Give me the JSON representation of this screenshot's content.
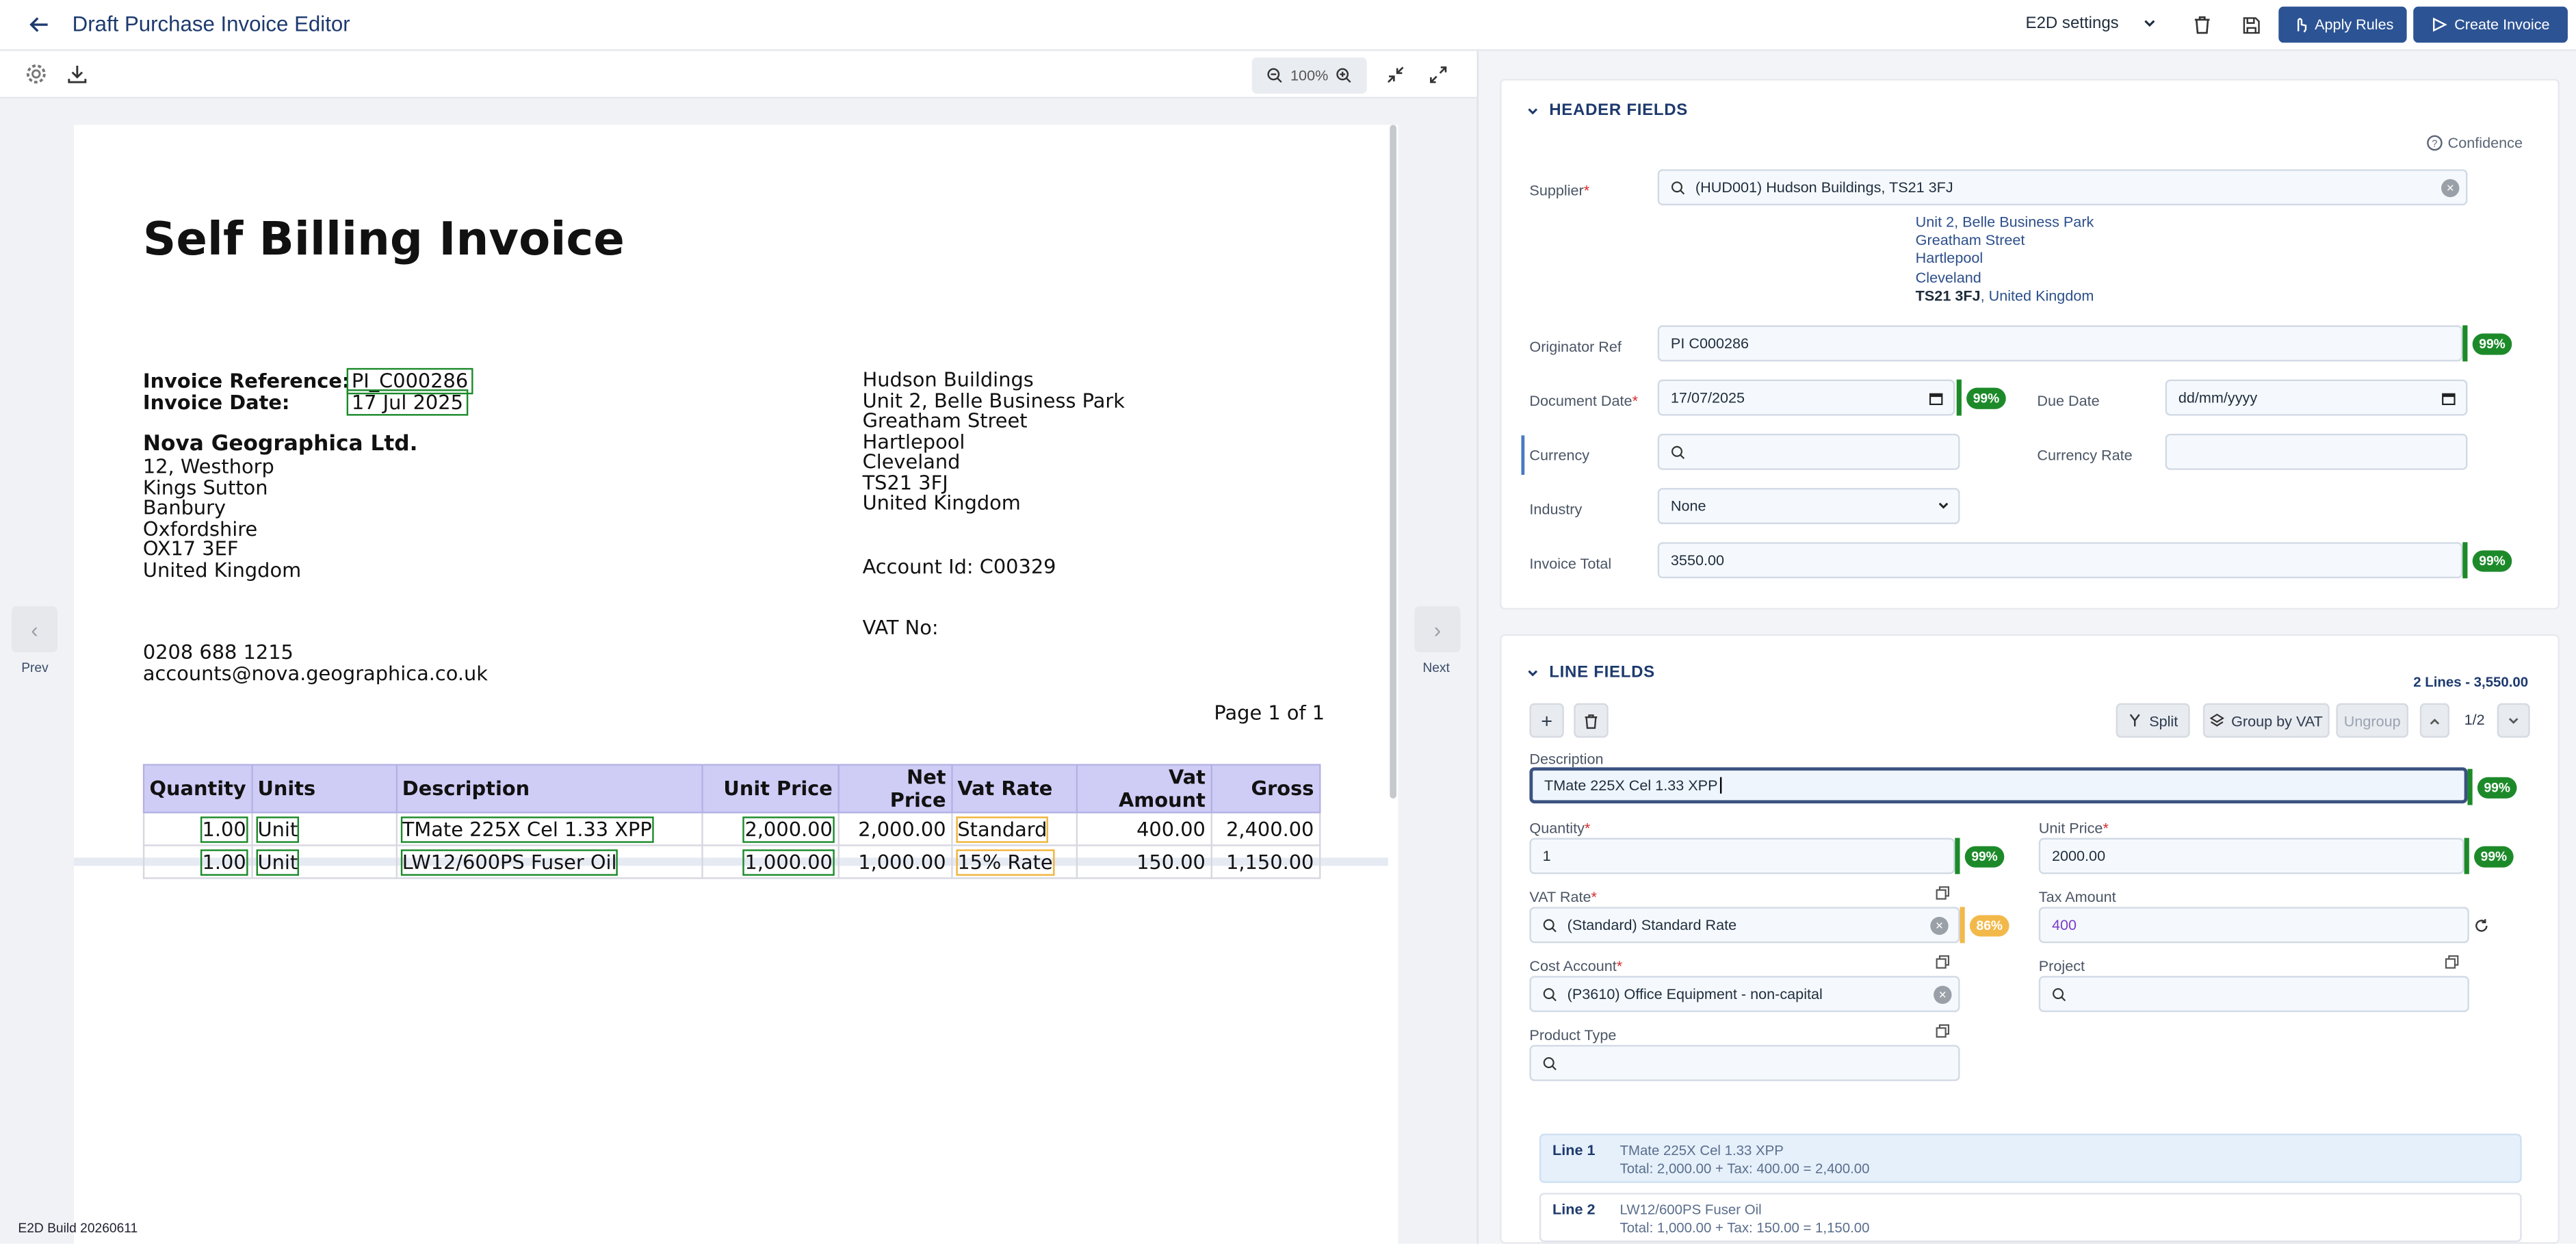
{
  "header": {
    "title": "Draft Purchase Invoice Editor",
    "settings_label": "E2D settings",
    "apply_rules_label": "Apply Rules",
    "create_invoice_label": "Create Invoice"
  },
  "toolbar": {
    "zoom": "100%"
  },
  "nav": {
    "prev_label": "Prev",
    "next_label": "Next"
  },
  "build": "E2D Build 20260611",
  "document": {
    "heading": "Self Billing Invoice",
    "ref_label": "Invoice Reference:",
    "ref_value": "PI_C000286",
    "date_label": "Invoice Date:",
    "date_value": "17 Jul 2025",
    "company": "Nova Geographica Ltd.",
    "company_address": [
      "12, Westhorp",
      "Kings Sutton",
      "Banbury",
      "Oxfordshire",
      "OX17 3EF",
      "United Kingdom"
    ],
    "phone": "0208 688 1215",
    "email": "accounts@nova.geographica.co.uk",
    "supplier_address": [
      "Hudson Buildings",
      "Unit 2, Belle Business Park",
      "Greatham Street",
      "Hartlepool",
      "Cleveland",
      "TS21 3FJ",
      "United Kingdom"
    ],
    "account_id": "Account Id:  C00329",
    "vat_no": "VAT No:",
    "page": "Page 1 of 1",
    "table": {
      "headers": [
        "Quantity",
        "Units",
        "Description",
        "Unit Price",
        "Net Price",
        "Vat Rate",
        "Vat Amount",
        "Gross"
      ],
      "rows": [
        [
          "1.00",
          "Unit",
          "TMate 225X Cel 1.33 XPP",
          "2,000.00",
          "2,000.00",
          "Standard",
          "400.00",
          "2,400.00"
        ],
        [
          "1.00",
          "Unit",
          "LW12/600PS Fuser Oil",
          "1,000.00",
          "1,000.00",
          "15% Rate",
          "150.00",
          "1,150.00"
        ]
      ]
    }
  },
  "header_fields": {
    "title": "HEADER FIELDS",
    "confidence_label": "Confidence",
    "supplier_label": "Supplier",
    "supplier_value": "(HUD001) Hudson Buildings, TS21 3FJ",
    "supplier_address": [
      "Unit 2, Belle Business Park",
      "Greatham Street",
      "Hartlepool",
      "Cleveland"
    ],
    "supplier_postcode": "TS21 3FJ",
    "supplier_country": ", United Kingdom",
    "originator_label": "Originator Ref",
    "originator_value": "PI C000286",
    "originator_conf": "99%",
    "docdate_label": "Document Date",
    "docdate_value": "17/07/2025",
    "docdate_conf": "99%",
    "duedate_label": "Due Date",
    "duedate_placeholder": "dd/mm/yyyy",
    "currency_label": "Currency",
    "currencyrate_label": "Currency Rate",
    "industry_label": "Industry",
    "industry_value": "None",
    "total_label": "Invoice Total",
    "total_value": "3550.00",
    "total_conf": "99%"
  },
  "line_fields": {
    "title": "LINE FIELDS",
    "summary": "2 Lines - 3,550.00",
    "split_label": "Split",
    "group_label": "Group by VAT",
    "ungroup_label": "Ungroup",
    "pager": "1/2",
    "description_label": "Description",
    "description_value": "TMate 225X Cel 1.33 XPP",
    "description_conf": "99%",
    "quantity_label": "Quantity",
    "quantity_value": "1",
    "quantity_conf": "99%",
    "unitprice_label": "Unit Price",
    "unitprice_value": "2000.00",
    "unitprice_conf": "99%",
    "vatrate_label": "VAT Rate",
    "vatrate_value": "(Standard) Standard Rate",
    "vatrate_conf": "86%",
    "taxamount_label": "Tax Amount",
    "taxamount_value": "400",
    "costaccount_label": "Cost Account",
    "costaccount_value": "(P3610) Office Equipment - non-capital",
    "project_label": "Project",
    "producttype_label": "Product Type",
    "lines": [
      {
        "label": "Line 1",
        "desc": "TMate 225X Cel 1.33 XPP",
        "total": "Total: 2,000.00 + Tax: 400.00 = 2,400.00"
      },
      {
        "label": "Line 2",
        "desc": "LW12/600PS Fuser Oil",
        "total": "Total: 1,000.00 + Tax: 150.00 = 1,150.00"
      }
    ]
  },
  "colors": {
    "primary": "#2c5394",
    "confidence_high": "#1d8a2a",
    "confidence_mid": "#f2b94a",
    "table_header": "#cfcdf6"
  }
}
